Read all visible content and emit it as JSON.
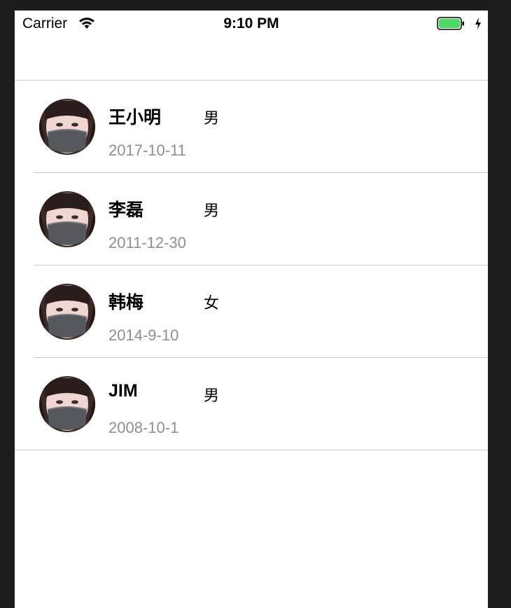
{
  "status_bar": {
    "carrier": "Carrier",
    "time": "9:10 PM",
    "wifi_icon": "wifi-icon",
    "battery_icon": "battery-icon",
    "battery_color": "#4cd964"
  },
  "colors": {
    "background": "#1c1c1c",
    "separator": "#c8c7cc",
    "date_text": "#8e8e93"
  },
  "people": [
    {
      "name": "王小明",
      "gender": "男",
      "date": "2017-10-11",
      "avatar": "avatar-photo"
    },
    {
      "name": "李磊",
      "gender": "男",
      "date": "2011-12-30",
      "avatar": "avatar-photo"
    },
    {
      "name": "韩梅",
      "gender": "女",
      "date": "2014-9-10",
      "avatar": "avatar-photo"
    },
    {
      "name": "JIM",
      "gender": "男",
      "date": "2008-10-1",
      "avatar": "avatar-photo"
    }
  ]
}
